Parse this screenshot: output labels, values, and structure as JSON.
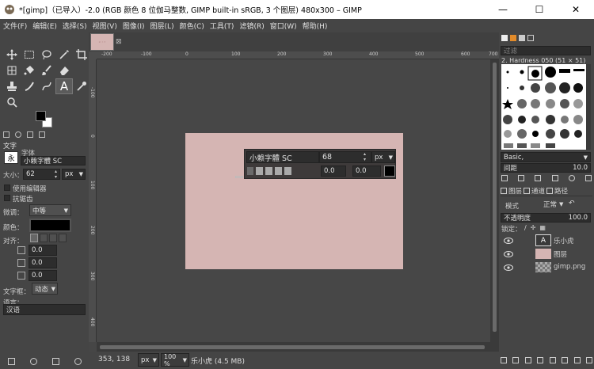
{
  "window": {
    "title": "*[gimp]（已导入）-2.0 (RGB 颜色 8 位伽马整数, GIMP built-in sRGB, 3 个图层) 480x300 – GIMP",
    "minimize": "—",
    "maximize": "☐",
    "close": "✕"
  },
  "menu": [
    "文件(F)",
    "编辑(E)",
    "选择(S)",
    "视图(V)",
    "图像(I)",
    "图层(L)",
    "颜色(C)",
    "工具(T)",
    "滤镜(R)",
    "窗口(W)",
    "帮助(H)"
  ],
  "text_tool": {
    "header": "文字",
    "font_label": "字体",
    "font_value": "小赖字體 SC",
    "size_label": "大小：",
    "size_value": "62",
    "size_unit": "px",
    "use_editor_label": "使用编辑器",
    "antialias_label": "抗锯齿",
    "hinting_label": "微调：",
    "hinting_value": "中等",
    "color_label": "颜色：",
    "justify_label": "对齐：",
    "indent_value": "0.0",
    "line_spacing_value": "0.0",
    "letter_spacing_value": "0.0",
    "box_label": "文字框：",
    "box_value": "动态",
    "language_label": "语言：",
    "language_value": "汉语"
  },
  "canvas": {
    "tab_thumb_text": "ᵖᶦ ˢ ᵈ",
    "colors": {
      "image_bg": "#d5b5b3",
      "canvas_bg": "#474747"
    }
  },
  "ruler": {
    "h_ticks": [
      "-200",
      "-100",
      "0",
      "100",
      "200",
      "300",
      "400",
      "500",
      "600",
      "700"
    ],
    "v_ticks": [
      "-100",
      "0",
      "100",
      "200",
      "300",
      "400"
    ]
  },
  "text_overlay": {
    "font": "小赖字體 SC",
    "size": "68",
    "unit": "px",
    "baseline": "0.0",
    "kerning": "0.0"
  },
  "status": {
    "coords": "353, 138",
    "unit": "px",
    "zoom": "100 %",
    "layer_info": "乐小虎 (4.5 MB)"
  },
  "brushes": {
    "title": "过滤",
    "current": "2. Hardness 050 (51 × 51)",
    "preset": "Basic,",
    "spacing_label": "间距",
    "spacing_value": "10.0"
  },
  "layers": {
    "tabs": [
      "图层",
      "通道",
      "路径"
    ],
    "mode_label": "模式",
    "mode_value": "正常",
    "opacity_label": "不透明度",
    "opacity_value": "100.0",
    "lock_label": "锁定：",
    "items": [
      {
        "name": "乐小虎",
        "type": "text"
      },
      {
        "name": "图层",
        "type": "fill"
      },
      {
        "name": "gimp.png",
        "type": "checker"
      }
    ]
  }
}
